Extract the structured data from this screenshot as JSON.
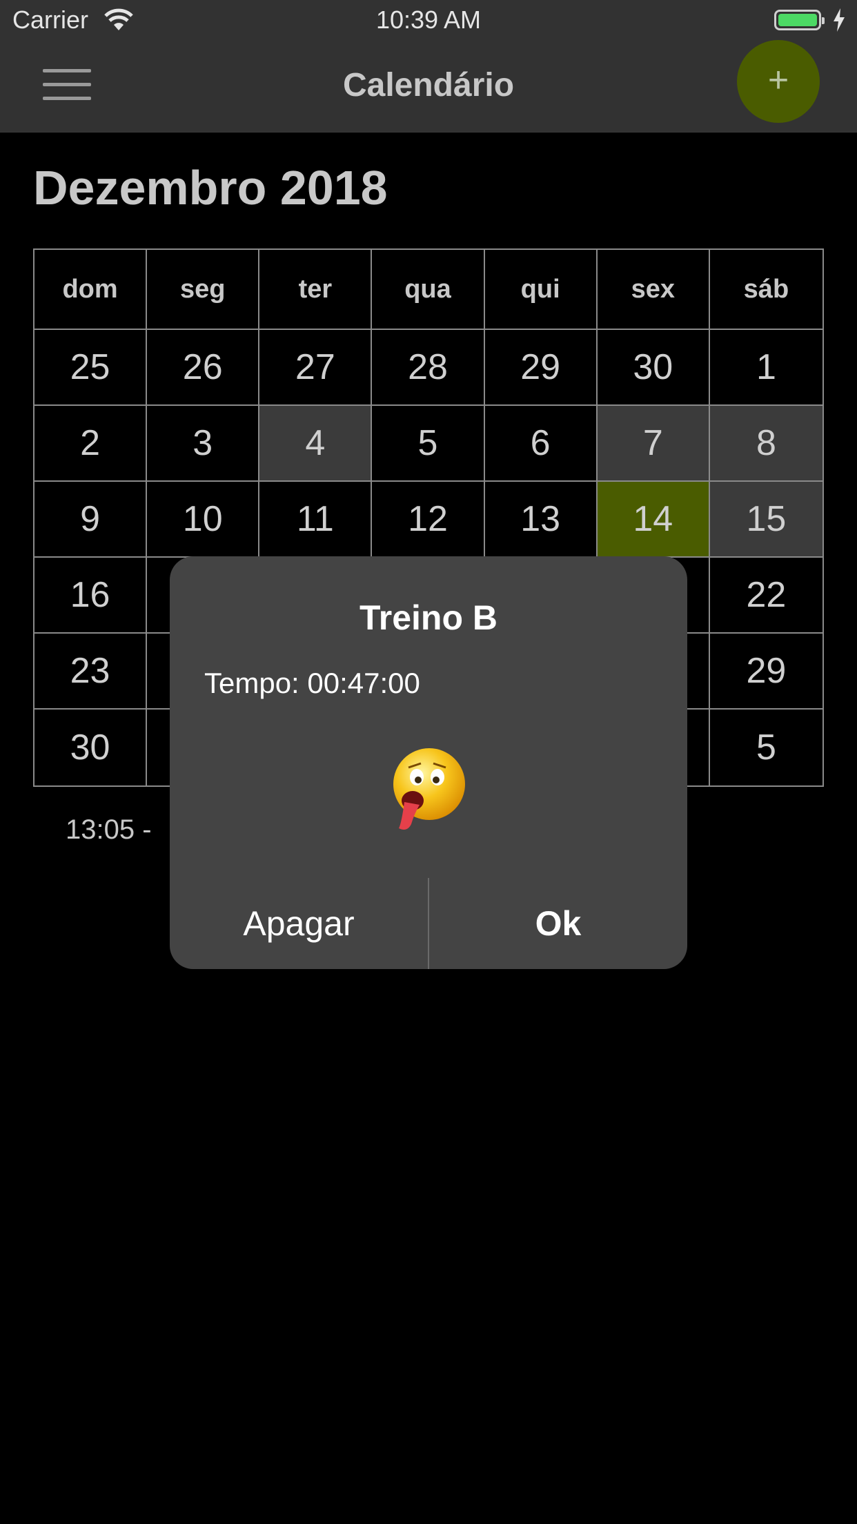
{
  "status_bar": {
    "carrier": "Carrier",
    "time": "10:39 AM"
  },
  "nav": {
    "title": "Calendário",
    "menu_icon": "hamburger-menu-icon",
    "add_icon": "plus-icon",
    "accent": "#4a5c00"
  },
  "calendar": {
    "month_title": "Dezembro 2018",
    "weekdays": [
      "dom",
      "seg",
      "ter",
      "qua",
      "qui",
      "sex",
      "sáb"
    ],
    "weeks": [
      [
        "25",
        "26",
        "27",
        "28",
        "29",
        "30",
        "1"
      ],
      [
        "2",
        "3",
        "4",
        "5",
        "6",
        "7",
        "8"
      ],
      [
        "9",
        "10",
        "11",
        "12",
        "13",
        "14",
        "15"
      ],
      [
        "16",
        "",
        "",
        "",
        "",
        "",
        "22"
      ],
      [
        "23",
        "",
        "",
        "",
        "",
        "",
        "29"
      ],
      [
        "30",
        "",
        "",
        "",
        "",
        "",
        "5"
      ]
    ],
    "highlighted_days": [
      "4",
      "7",
      "8",
      "15"
    ],
    "selected_day": "14"
  },
  "event_line": "13:05 -",
  "alert": {
    "title": "Treino B",
    "message": "Tempo: 00:47:00",
    "emoji_icon": "exhausted-face-emoji-icon",
    "left_button": "Apagar",
    "right_button": "Ok"
  }
}
